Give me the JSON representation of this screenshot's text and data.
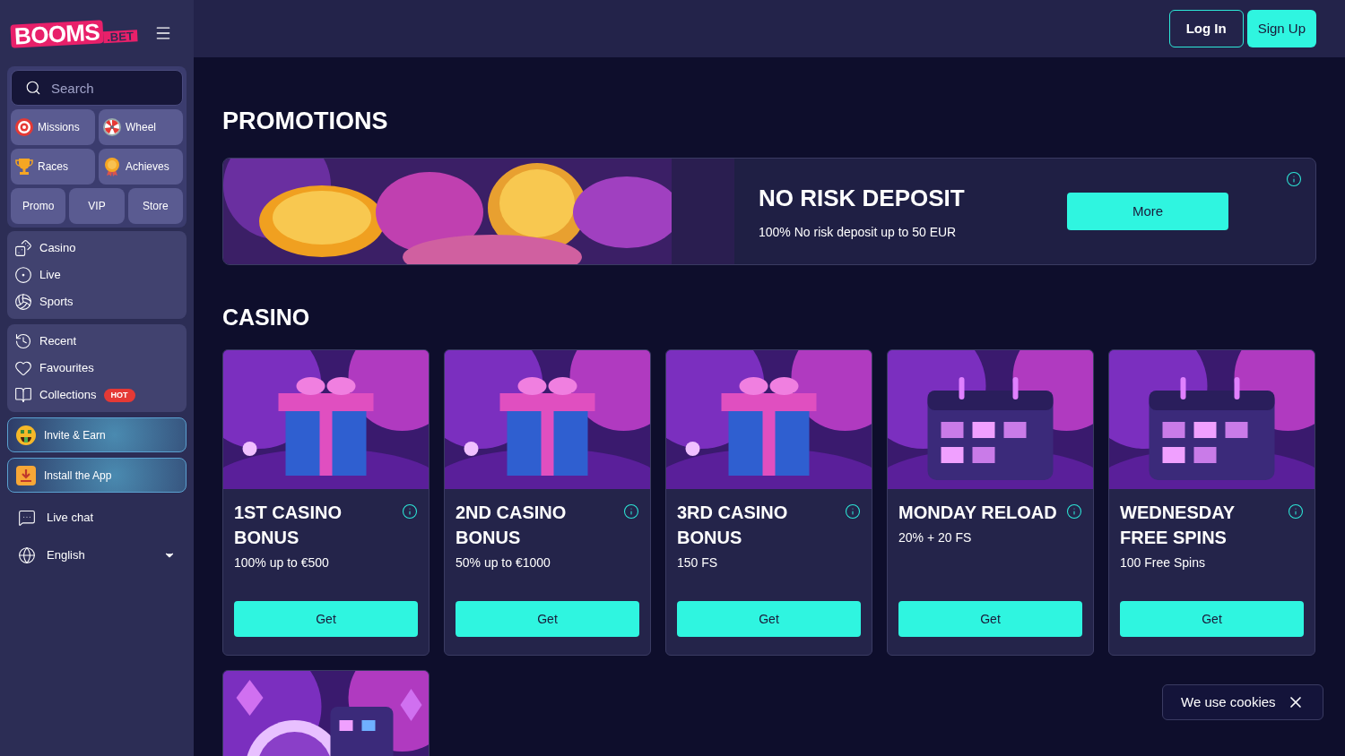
{
  "logo": {
    "main": "BOOMS",
    "suffix": ".BET"
  },
  "header": {
    "buttons": [
      {
        "label": "Log In",
        "kind": "outline"
      },
      {
        "label": "Sign Up",
        "kind": "filled"
      }
    ]
  },
  "sidebar": {
    "search": {
      "placeholder": "Search"
    },
    "quick_links": [
      {
        "label": "Missions",
        "kind": "target"
      },
      {
        "label": "Wheel",
        "kind": "wheel"
      },
      {
        "label": "Races",
        "kind": "trophy"
      },
      {
        "label": "Achieves",
        "kind": "medal"
      }
    ],
    "small_links": [
      "Promo",
      "VIP",
      "Store"
    ],
    "nav": [
      {
        "label": "Casino",
        "kind": "dice"
      },
      {
        "label": "Live",
        "kind": "live"
      },
      {
        "label": "Sports",
        "kind": "ball"
      }
    ],
    "personal": [
      {
        "label": "Recent",
        "kind": "history"
      },
      {
        "label": "Favourites",
        "kind": "heart"
      },
      {
        "label": "Collections",
        "kind": "book",
        "badge": "HOT"
      }
    ],
    "banners": [
      {
        "label": "Invite & Earn",
        "kind": "emoji"
      },
      {
        "label": "Install the App",
        "kind": "download"
      }
    ],
    "live_chat": "Live chat",
    "language": "English"
  },
  "promotions": {
    "title": "PROMOTIONS",
    "banner": {
      "title": "NO RISK DEPOSIT",
      "text": "100% No risk deposit up to 50 EUR",
      "button": "More"
    }
  },
  "casino": {
    "title": "CASINO",
    "cards": [
      {
        "title": "1ST CASINO BONUS",
        "text": "100% up to €500",
        "button": "Get"
      },
      {
        "title": "2ND CASINO BONUS",
        "text": "50% up to €1000",
        "button": "Get"
      },
      {
        "title": "3RD CASINO BONUS",
        "text": "150 FS",
        "button": "Get"
      },
      {
        "title": "MONDAY RELOAD",
        "text": "20% + 20 FS",
        "button": "Get"
      },
      {
        "title": "WEDNESDAY FREE SPINS",
        "text": "100 Free Spins",
        "button": "Get"
      }
    ]
  },
  "cookie": {
    "text": "We use cookies"
  }
}
